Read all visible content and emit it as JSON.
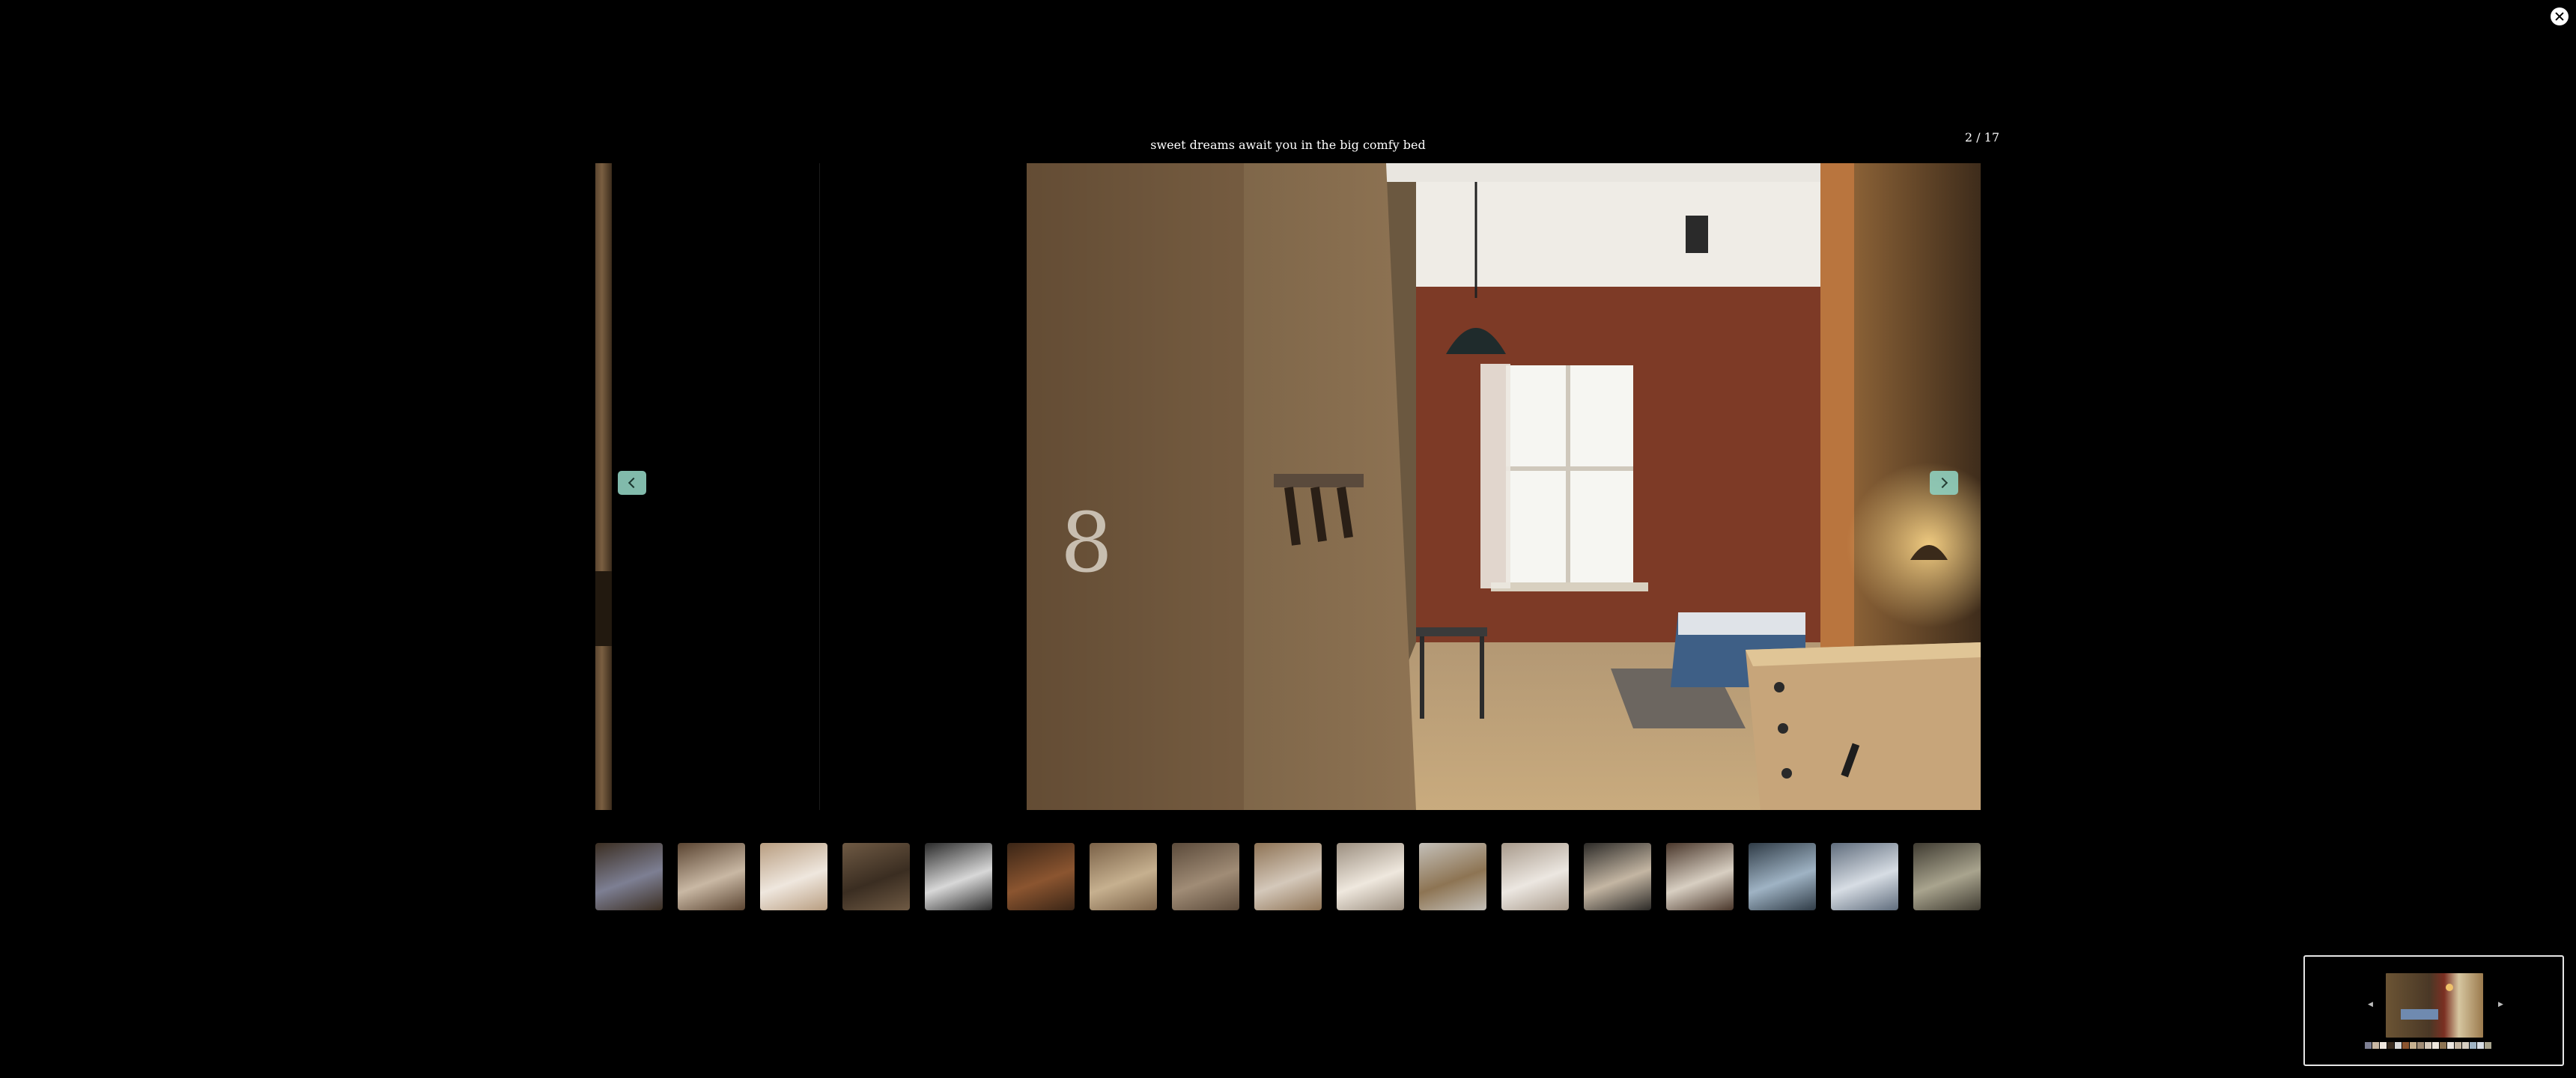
{
  "viewer": {
    "caption": "sweet dreams await you in the big comfy bed",
    "counter": "2 / 17",
    "current_index": 2,
    "total": 17
  },
  "icons": {
    "close": "close-icon",
    "prev": "chevron-left-icon",
    "next": "chevron-right-icon"
  },
  "colors": {
    "background": "#000000",
    "nav_button": "#8fcfbe",
    "close_button": "#ffffff"
  },
  "thumbnails": [
    {
      "colors": [
        "#3b2e22",
        "#7d7f93"
      ]
    },
    {
      "colors": [
        "#5a4431",
        "#c9b8a4"
      ]
    },
    {
      "colors": [
        "#b89d80",
        "#efe7de"
      ]
    },
    {
      "colors": [
        "#6f5a44",
        "#3a2d21"
      ]
    },
    {
      "colors": [
        "#2a2a2a",
        "#d8d8d8"
      ]
    },
    {
      "colors": [
        "#3a2516",
        "#8b5530"
      ]
    },
    {
      "colors": [
        "#7a6147",
        "#c6b08f"
      ]
    },
    {
      "colors": [
        "#5b4a3a",
        "#a08c76"
      ]
    },
    {
      "colors": [
        "#8e7355",
        "#d4c8ba"
      ]
    },
    {
      "colors": [
        "#9b8e7f",
        "#efe8de"
      ]
    },
    {
      "colors": [
        "#c4c0b9",
        "#8d7453"
      ]
    },
    {
      "colors": [
        "#a89a8b",
        "#ece7e1"
      ]
    },
    {
      "colors": [
        "#2c2a27",
        "#c4b6a3"
      ]
    },
    {
      "colors": [
        "#49362a",
        "#d8cfc2"
      ]
    },
    {
      "colors": [
        "#2f3b46",
        "#9fb3c4"
      ]
    },
    {
      "colors": [
        "#5f6c7c",
        "#d7dde4"
      ]
    },
    {
      "colors": [
        "#3f3b31",
        "#a9a48e"
      ]
    }
  ]
}
